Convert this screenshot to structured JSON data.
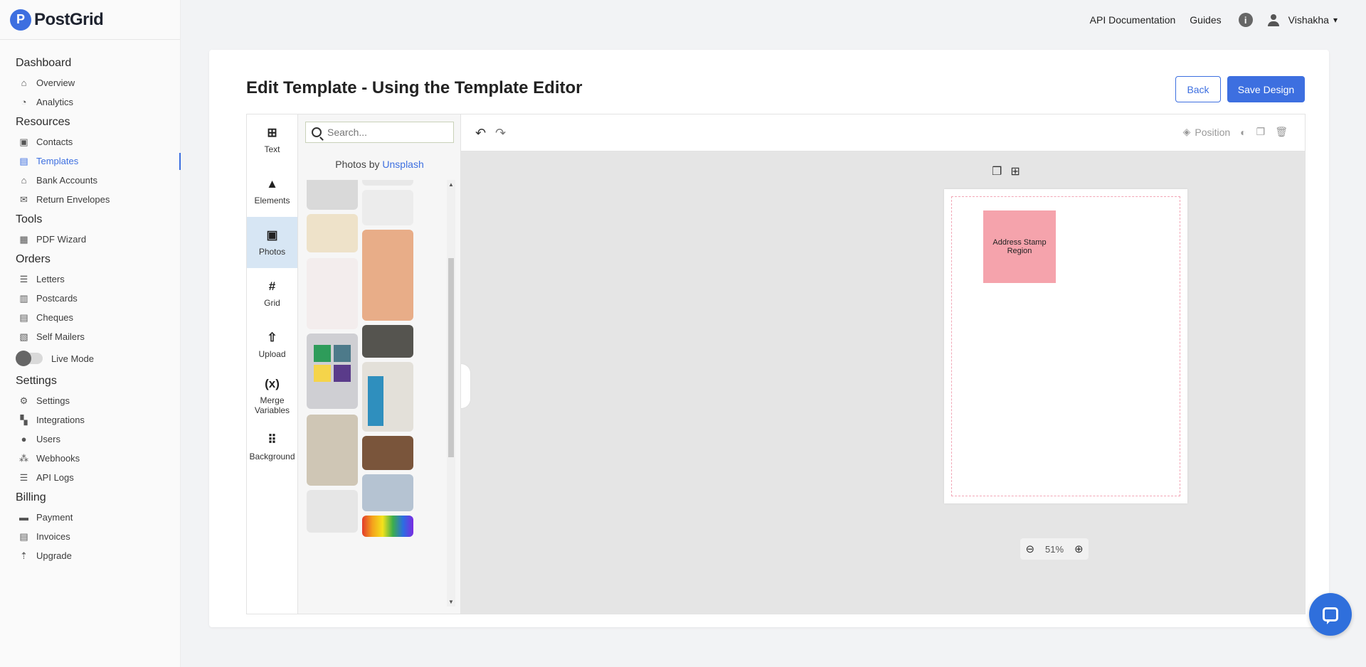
{
  "brand": {
    "name": "PostGrid",
    "logo_letter": "P"
  },
  "topbar": {
    "api_docs": "API Documentation",
    "guides": "Guides",
    "user": "Vishakha"
  },
  "sidebar": {
    "sections": {
      "dashboard": "Dashboard",
      "resources": "Resources",
      "tools": "Tools",
      "orders": "Orders",
      "settings": "Settings",
      "billing": "Billing"
    },
    "items": {
      "overview": "Overview",
      "analytics": "Analytics",
      "contacts": "Contacts",
      "templates": "Templates",
      "bank_accounts": "Bank Accounts",
      "return_envelopes": "Return Envelopes",
      "pdf_wizard": "PDF Wizard",
      "letters": "Letters",
      "postcards": "Postcards",
      "cheques": "Cheques",
      "self_mailers": "Self Mailers",
      "live_mode": "Live Mode",
      "settings": "Settings",
      "integrations": "Integrations",
      "users": "Users",
      "webhooks": "Webhooks",
      "api_logs": "API Logs",
      "payment": "Payment",
      "invoices": "Invoices",
      "upgrade": "Upgrade"
    },
    "active": "templates"
  },
  "page": {
    "title": "Edit Template - Using the Template Editor",
    "back": "Back",
    "save": "Save Design"
  },
  "tools": {
    "text": "Text",
    "elements": "Elements",
    "photos": "Photos",
    "grid": "Grid",
    "upload": "Upload",
    "merge_variables_1": "Merge",
    "merge_variables_2": "Variables",
    "merge_icon": "(x)",
    "background": "Background"
  },
  "photos_panel": {
    "search_placeholder": "Search...",
    "photos_by": "Photos by ",
    "unsplash": "Unsplash"
  },
  "canvas": {
    "position": "Position",
    "stamp_label": "Address Stamp Region",
    "zoom": "51%"
  },
  "colors": {
    "accent": "#3d6fe0",
    "stamp": "#f5a3ac",
    "page_guide": "#f2a6b6"
  }
}
